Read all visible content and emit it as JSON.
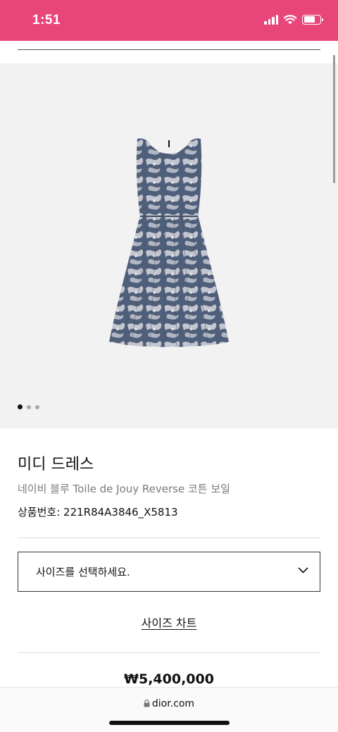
{
  "status_bar": {
    "time": "1:51",
    "background": "#e8457a",
    "icons": [
      "signal-icon",
      "wifi-icon",
      "battery-icon"
    ]
  },
  "gallery": {
    "image_alt": "dress-image",
    "slide_count": 3,
    "active_slide": 1
  },
  "product": {
    "title": "미디 드레스",
    "subtitle": "네이비 블루 Toile de Jouy Reverse 코튼 보일",
    "sku": "상품번호: 221R84A3846_X5813",
    "size_select_placeholder": "사이즈를 선택하세요.",
    "size_chart_label": "사이즈 차트",
    "price": "₩5,400,000"
  },
  "browser": {
    "url": "dior.com"
  },
  "colors": {
    "accent": "#e8457a",
    "gallery_bg": "#f2f2f3",
    "dress_navy": "#4f5f7a"
  }
}
